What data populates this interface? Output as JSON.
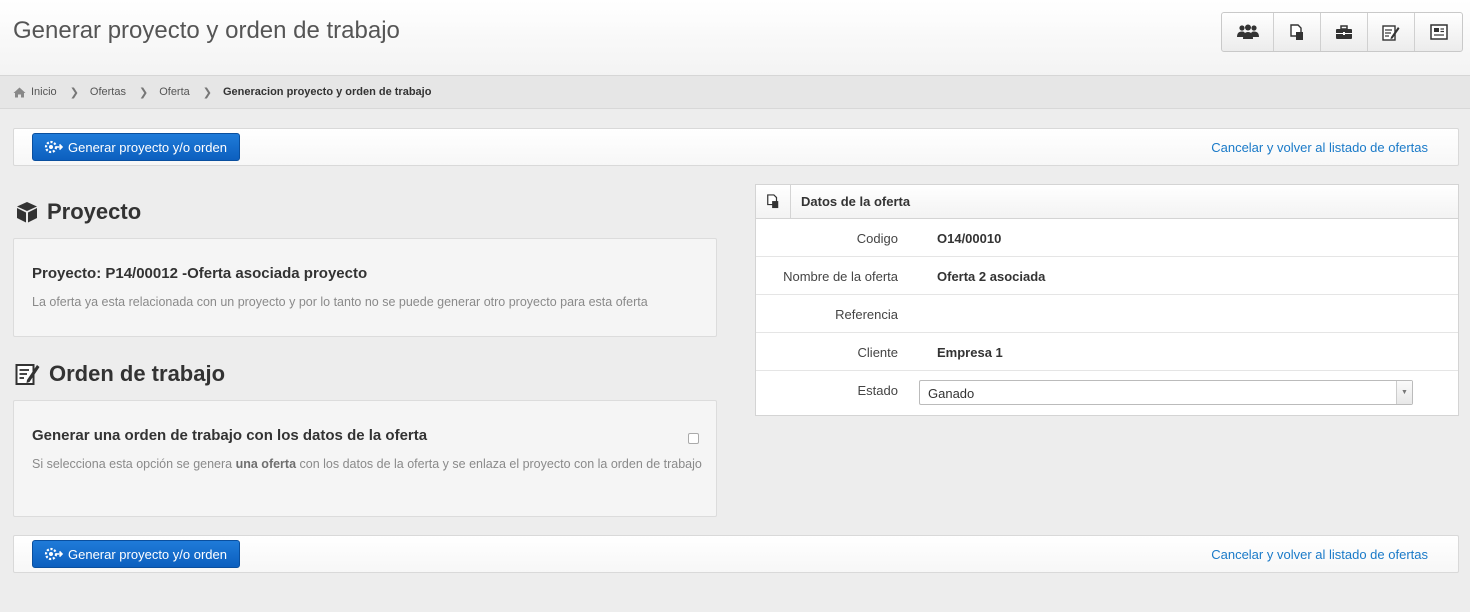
{
  "header": {
    "title": "Generar proyecto y orden de trabajo",
    "toolbar": [
      {
        "icon": "users-icon"
      },
      {
        "icon": "documents-icon"
      },
      {
        "icon": "briefcase-icon"
      },
      {
        "icon": "edit-icon"
      },
      {
        "icon": "contact-card-icon"
      }
    ]
  },
  "breadcrumb": {
    "home": "Inicio",
    "items": [
      "Ofertas",
      "Oferta"
    ],
    "current": "Generacion proyecto y orden de trabajo"
  },
  "actions": {
    "generate_label": "Generar proyecto y/o orden",
    "cancel_label": "Cancelar y volver al listado de ofertas"
  },
  "proyecto": {
    "section_title": "Proyecto",
    "heading": "Proyecto: P14/00012 -Oferta asociada proyecto",
    "note": "La oferta ya esta relacionada con un proyecto y por lo tanto no se puede generar otro proyecto para esta oferta"
  },
  "orden": {
    "section_title": "Orden de trabajo",
    "heading": "Generar una orden de trabajo con los datos de la oferta",
    "checked": false,
    "note_part1": "Si selecciona esta opción se genera ",
    "note_bold": "una oferta",
    "note_part2": " con los datos de la oferta y se enlaza el proyecto con la orden de trabajo"
  },
  "oferta": {
    "panel_title": "Datos de la oferta",
    "fields": [
      {
        "label": "Codigo",
        "value": "O14/00010"
      },
      {
        "label": "Nombre de la oferta",
        "value": "Oferta 2 asociada"
      },
      {
        "label": "Referencia",
        "value": ""
      },
      {
        "label": "Cliente",
        "value": "Empresa 1"
      }
    ],
    "estado_label": "Estado",
    "estado_value": "Ganado"
  },
  "colors": {
    "primary": "#0c5fbf",
    "link": "#1a7ac8"
  }
}
